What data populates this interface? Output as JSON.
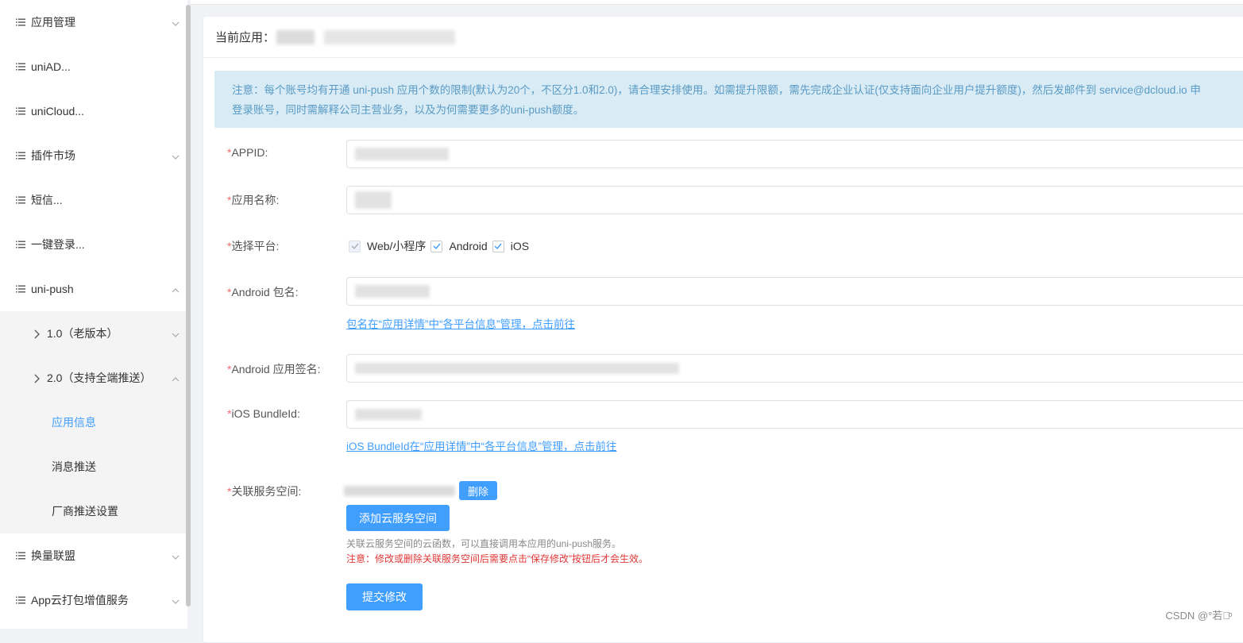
{
  "sidebar": {
    "items": [
      {
        "label": "应用管理",
        "chevron": "down"
      },
      {
        "label": "uniAD...",
        "chevron": ""
      },
      {
        "label": "uniCloud...",
        "chevron": ""
      },
      {
        "label": "插件市场",
        "chevron": "down"
      },
      {
        "label": "短信...",
        "chevron": ""
      },
      {
        "label": "一键登录...",
        "chevron": ""
      },
      {
        "label": "uni-push",
        "chevron": "up"
      }
    ],
    "sub_items": [
      {
        "label": "1.0（老版本）",
        "chevron": "down"
      },
      {
        "label": "2.0（支持全端推送）",
        "chevron": "up"
      }
    ],
    "leaf_items": [
      {
        "label": "应用信息",
        "active": true
      },
      {
        "label": "消息推送",
        "active": false
      },
      {
        "label": "厂商推送设置",
        "active": false
      }
    ],
    "bottom_items": [
      {
        "label": "换量联盟",
        "chevron": "down"
      },
      {
        "label": "App云打包增值服务",
        "chevron": "down"
      }
    ]
  },
  "header": {
    "current_app_label": "当前应用："
  },
  "notice": {
    "line1": "注意：每个账号均有开通 uni-push 应用个数的限制(默认为20个，不区分1.0和2.0)，请合理安排使用。如需提升限额，需先完成企业认证(仅支持面向企业用户提升额度)，然后发邮件到 service@dcloud.io 申",
    "line2": "登录账号，同时需解释公司主营业务，以及为何需要更多的uni-push额度。"
  },
  "form": {
    "appid_label": "APPID:",
    "appname_label": "应用名称:",
    "platform_label": "选择平台:",
    "platforms": [
      "Web/小程序",
      "Android",
      "iOS"
    ],
    "android_pkg_label": "Android 包名:",
    "android_pkg_link": "包名在“应用详情”中“各平台信息”管理，点击前往",
    "android_sign_label": "Android 应用签名:",
    "ios_bundle_label": "iOS BundleId:",
    "ios_bundle_link": "iOS BundleId在“应用详情”中“各平台信息”管理，点击前往",
    "service_space_label": "关联服务空间:",
    "delete_button": "删除",
    "add_space_button": "添加云服务空间",
    "hint": "关联云服务空间的云函数，可以直接调用本应用的uni-push服务。",
    "warning": "注意：修改或删除关联服务空间后需要点击“保存修改”按钮后才会生效。",
    "submit_button": "提交修改",
    "required_mark": "*"
  },
  "watermark": "CSDN @°若水ͦ",
  "colors": {
    "primary": "#409eff",
    "notice_bg": "#d9ecf6",
    "required": "#f56c6c",
    "warning": "#e03636"
  }
}
